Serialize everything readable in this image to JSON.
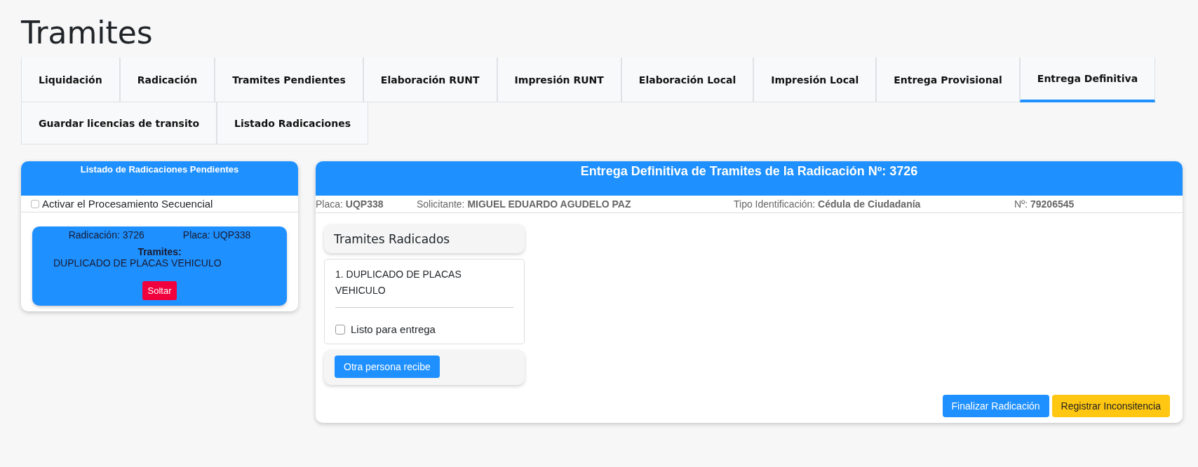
{
  "page_title": "Tramites",
  "tabs": [
    {
      "label": "Liquidación",
      "selected": false
    },
    {
      "label": "Radicación",
      "selected": false
    },
    {
      "label": "Tramites Pendientes",
      "selected": false
    },
    {
      "label": "Elaboración RUNT",
      "selected": false
    },
    {
      "label": "Impresión RUNT",
      "selected": false
    },
    {
      "label": "Elaboración Local",
      "selected": false
    },
    {
      "label": "Impresión Local",
      "selected": false
    },
    {
      "label": "Entrega Provisional",
      "selected": false
    },
    {
      "label": "Entrega Definitiva",
      "selected": true
    },
    {
      "label": "Guardar licencias de transito",
      "selected": false
    },
    {
      "label": "Listado Radicaciones",
      "selected": false
    }
  ],
  "pending_panel": {
    "title": "Listado de Radicaciones Pendientes",
    "sequential": {
      "label": "Activar el Procesamiento Secuencial",
      "checked": false
    },
    "items": [
      {
        "radicacion": "Radicación: 3726",
        "placa": "Placa: UQP338",
        "tramites_label": "Tramites:",
        "tramites": "DUPLICADO DE PLACAS VEHICULO",
        "button": "Soltar"
      }
    ]
  },
  "delivery_panel": {
    "title": "Entrega Definitiva de Tramites de la Radicación Nº: 3726",
    "info": [
      {
        "label": "Placa:",
        "value": "UQP338"
      },
      {
        "label": "Solicitante:",
        "value": "MIGUEL EDUARDO AGUDELO PAZ"
      },
      {
        "label": "Tipo Identificación:",
        "value": "Cédula de Ciudadanía"
      },
      {
        "label": "Nº:",
        "value": "79206545"
      }
    ],
    "tramites_title": "Tramites Radicados",
    "tramites": [
      {
        "name": "1. DUPLICADO DE PLACAS VEHICULO",
        "ready_label": "Listo para entrega",
        "checked": false
      }
    ],
    "other_person_button": "Otra persona recibe",
    "buttons": [
      {
        "label": "Finalizar Radicación",
        "kind": "primary"
      },
      {
        "label": "Registrar Inconsitencia",
        "kind": "warning"
      }
    ]
  }
}
